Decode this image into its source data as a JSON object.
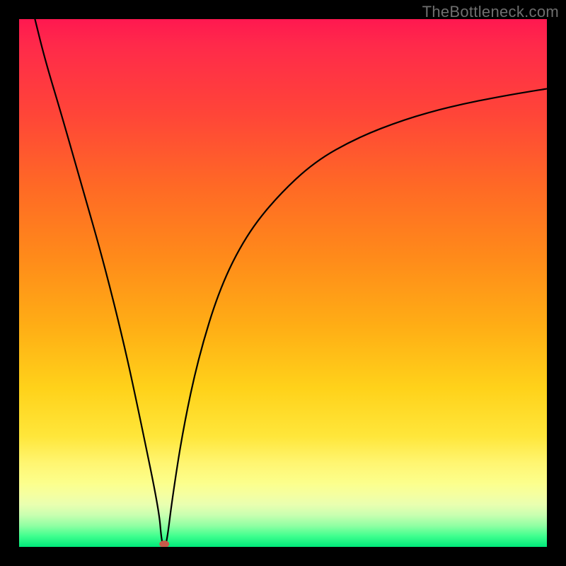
{
  "watermark": "TheBottleneck.com",
  "chart_data": {
    "type": "line",
    "title": "",
    "xlabel": "",
    "ylabel": "",
    "xlim": [
      0,
      100
    ],
    "ylim": [
      0,
      100
    ],
    "grid": false,
    "legend": false,
    "x": [
      3,
      5,
      8,
      12,
      16,
      20,
      23,
      26.5,
      27,
      27.5,
      28,
      29,
      31,
      34,
      38,
      43,
      49,
      56,
      64,
      73,
      82,
      92,
      100
    ],
    "values": [
      100,
      92,
      82,
      68,
      54,
      38,
      24,
      7,
      1,
      0,
      1,
      9,
      22,
      36,
      49,
      59,
      66.5,
      73,
      77.5,
      81,
      83.5,
      85.5,
      86.8
    ],
    "marker": {
      "x": 27.5,
      "y": 0
    }
  }
}
